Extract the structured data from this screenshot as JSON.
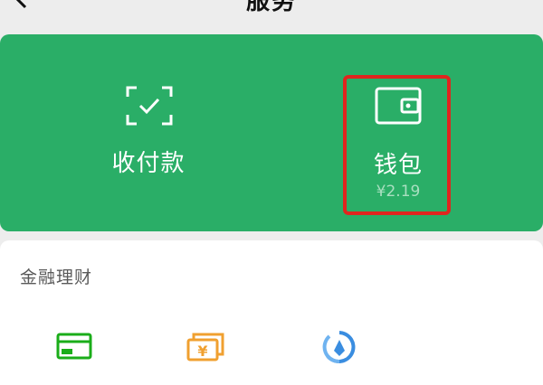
{
  "header": {
    "title": "服务",
    "back_icon": "chevron-left-icon"
  },
  "green_card": {
    "background": "#2aae67",
    "items": [
      {
        "label": "收付款",
        "icon": "scan-payment-icon"
      },
      {
        "label": "钱包",
        "icon": "wallet-icon",
        "balance": "¥2.19"
      }
    ],
    "highlight_color": "#e0251e"
  },
  "finance": {
    "section_title": "金融理财",
    "items": [
      {
        "icon": "credit-card-icon",
        "color": "#1aad19"
      },
      {
        "icon": "wealth-management-icon",
        "color": "#f0a030"
      },
      {
        "icon": "insurance-icon",
        "color": "#3a8de0"
      }
    ]
  }
}
